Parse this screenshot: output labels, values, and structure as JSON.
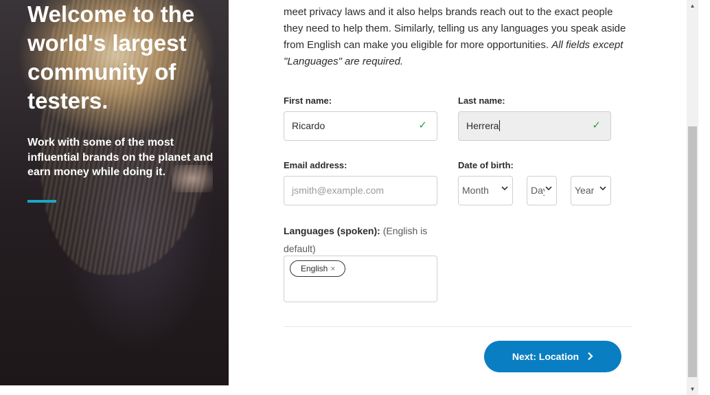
{
  "hero": {
    "title": "Welcome to the world's largest community of testers.",
    "subtitle": "Work with some of the most influential brands on the planet and earn money while doing it."
  },
  "intro": {
    "text": "meet privacy laws and it also helps brands reach out to the exact people they need to help them. Similarly, telling us any languages you speak aside from English can make you eligible for more opportunities.",
    "note": "All fields except \"Languages\" are required."
  },
  "form": {
    "first_name": {
      "label": "First name:",
      "value": "Ricardo"
    },
    "last_name": {
      "label": "Last name:",
      "value": "Herrera"
    },
    "email": {
      "label": "Email address:",
      "placeholder": "jsmith@example.com"
    },
    "dob": {
      "label": "Date of birth:",
      "month": "Month",
      "day": "Day",
      "year": "Year"
    },
    "languages": {
      "label": "Languages (spoken):",
      "hint": "(English is default)",
      "chips": [
        "English"
      ]
    }
  },
  "actions": {
    "next_label": "Next: Location"
  },
  "colors": {
    "accent": "#0a7ec2",
    "teal": "#1ba7c6",
    "success": "#2e9b4e"
  }
}
